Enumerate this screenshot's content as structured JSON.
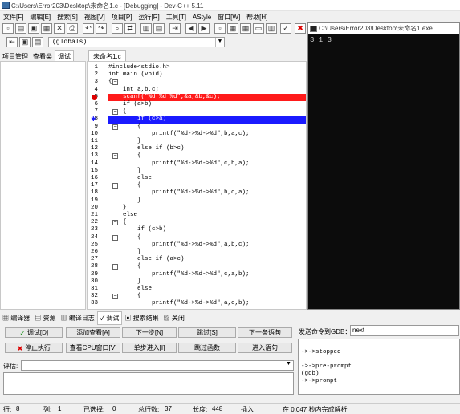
{
  "window": {
    "title": "C:\\Users\\Error203\\Desktop\\未命名1.c - [Debugging] - Dev-C++ 5.11"
  },
  "menu": [
    "文件[F]",
    "编辑[E]",
    "搜索[S]",
    "视图[V]",
    "项目[P]",
    "运行[R]",
    "工具[T]",
    "AStyle",
    "窗口[W]",
    "帮助[H]"
  ],
  "scope_select": {
    "value": "(globals)"
  },
  "left_tabs": [
    "项目管理",
    "查看类",
    "调试"
  ],
  "editor_tab": "未命名1.c",
  "code_lines": [
    {
      "n": "1",
      "t": "#include<stdio.h>"
    },
    {
      "n": "2",
      "t": "int main (void)"
    },
    {
      "n": "3",
      "t": "{"
    },
    {
      "n": "4",
      "t": "    int a,b,c;"
    },
    {
      "n": "5",
      "t": "    scanf(\"%d %d %d\",&a,&b,&c);"
    },
    {
      "n": "6",
      "t": "    if (a>b)"
    },
    {
      "n": "7",
      "t": "    {"
    },
    {
      "n": "8",
      "t": "        if (c>a)"
    },
    {
      "n": "9",
      "t": "        {"
    },
    {
      "n": "10",
      "t": "            printf(\"%d->%d->%d\",b,a,c);"
    },
    {
      "n": "11",
      "t": "        }"
    },
    {
      "n": "12",
      "t": "        else if (b>c)"
    },
    {
      "n": "13",
      "t": "        {"
    },
    {
      "n": "14",
      "t": "            printf(\"%d->%d->%d\",c,b,a);"
    },
    {
      "n": "15",
      "t": "        }"
    },
    {
      "n": "16",
      "t": "        else"
    },
    {
      "n": "17",
      "t": "        {"
    },
    {
      "n": "18",
      "t": "            printf(\"%d->%d->%d\",b,c,a);"
    },
    {
      "n": "19",
      "t": "        }"
    },
    {
      "n": "20",
      "t": "    }"
    },
    {
      "n": "21",
      "t": "    else"
    },
    {
      "n": "22",
      "t": "    {"
    },
    {
      "n": "23",
      "t": "        if (c>b)"
    },
    {
      "n": "24",
      "t": "        {"
    },
    {
      "n": "25",
      "t": "            printf(\"%d->%d->%d\",a,b,c);"
    },
    {
      "n": "26",
      "t": "        }"
    },
    {
      "n": "27",
      "t": "        else if (a>c)"
    },
    {
      "n": "28",
      "t": "        {"
    },
    {
      "n": "29",
      "t": "            printf(\"%d->%d->%d\",c,a,b);"
    },
    {
      "n": "30",
      "t": "        }"
    },
    {
      "n": "31",
      "t": "        else"
    },
    {
      "n": "32",
      "t": "        {"
    },
    {
      "n": "33",
      "t": "            printf(\"%d->%d->%d\",a,c,b);"
    }
  ],
  "console": {
    "title": "C:\\Users\\Error203\\Desktop\\未命名1.exe",
    "output": "3 1 3"
  },
  "bottom_tabs": [
    "编译器",
    "资源",
    "编译日志",
    "调试",
    "搜索结果",
    "关闭"
  ],
  "debug_buttons": {
    "debug": "调试[D]",
    "add_watch": "添加查看[A]",
    "next_step": "下一步[N]",
    "skip": "跳过[S]",
    "next_statement": "下一条语句",
    "stop": "停止执行",
    "cpu_window": "查看CPU窗口[V]",
    "step_into": "单步进入[I]",
    "skip_function": "跳过函数",
    "step_into_statement": "进入语句"
  },
  "gdb": {
    "label": "发送命令到GDB：",
    "value": "next",
    "output": [
      "",
      "->->stopped",
      "",
      "->->pre-prompt",
      "(gdb)",
      "->->prompt"
    ]
  },
  "eval": {
    "label": "评估:"
  },
  "status": {
    "row_label": "行:",
    "row": "8",
    "col_label": "列:",
    "col": "1",
    "sel_label": "已选择:",
    "sel": "0",
    "total_label": "总行数:",
    "total": "37",
    "len_label": "长度:",
    "len": "448",
    "mode": "插入",
    "parse": "在 0.047 秒内完成解析"
  }
}
